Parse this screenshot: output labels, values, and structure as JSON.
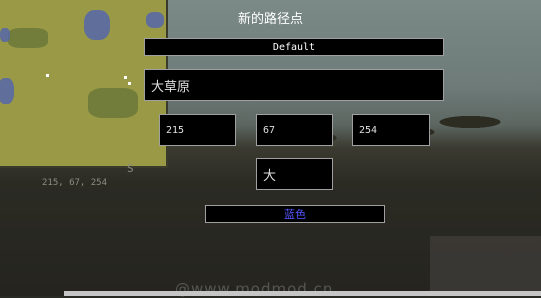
{
  "screen": {
    "title": "新的路径点"
  },
  "waypoint": {
    "set_button_label": "Default",
    "name_value": "大草原",
    "x_value": "215",
    "y_value": "67",
    "z_value": "254",
    "suffix_value": "大",
    "color_button_label": "蓝色",
    "color_button_text_color": "#5555ff"
  },
  "minimap": {
    "compass_label": "S",
    "coordinates_text": "215, 67, 254"
  },
  "watermark": {
    "text": "@www.modmod.cn"
  }
}
